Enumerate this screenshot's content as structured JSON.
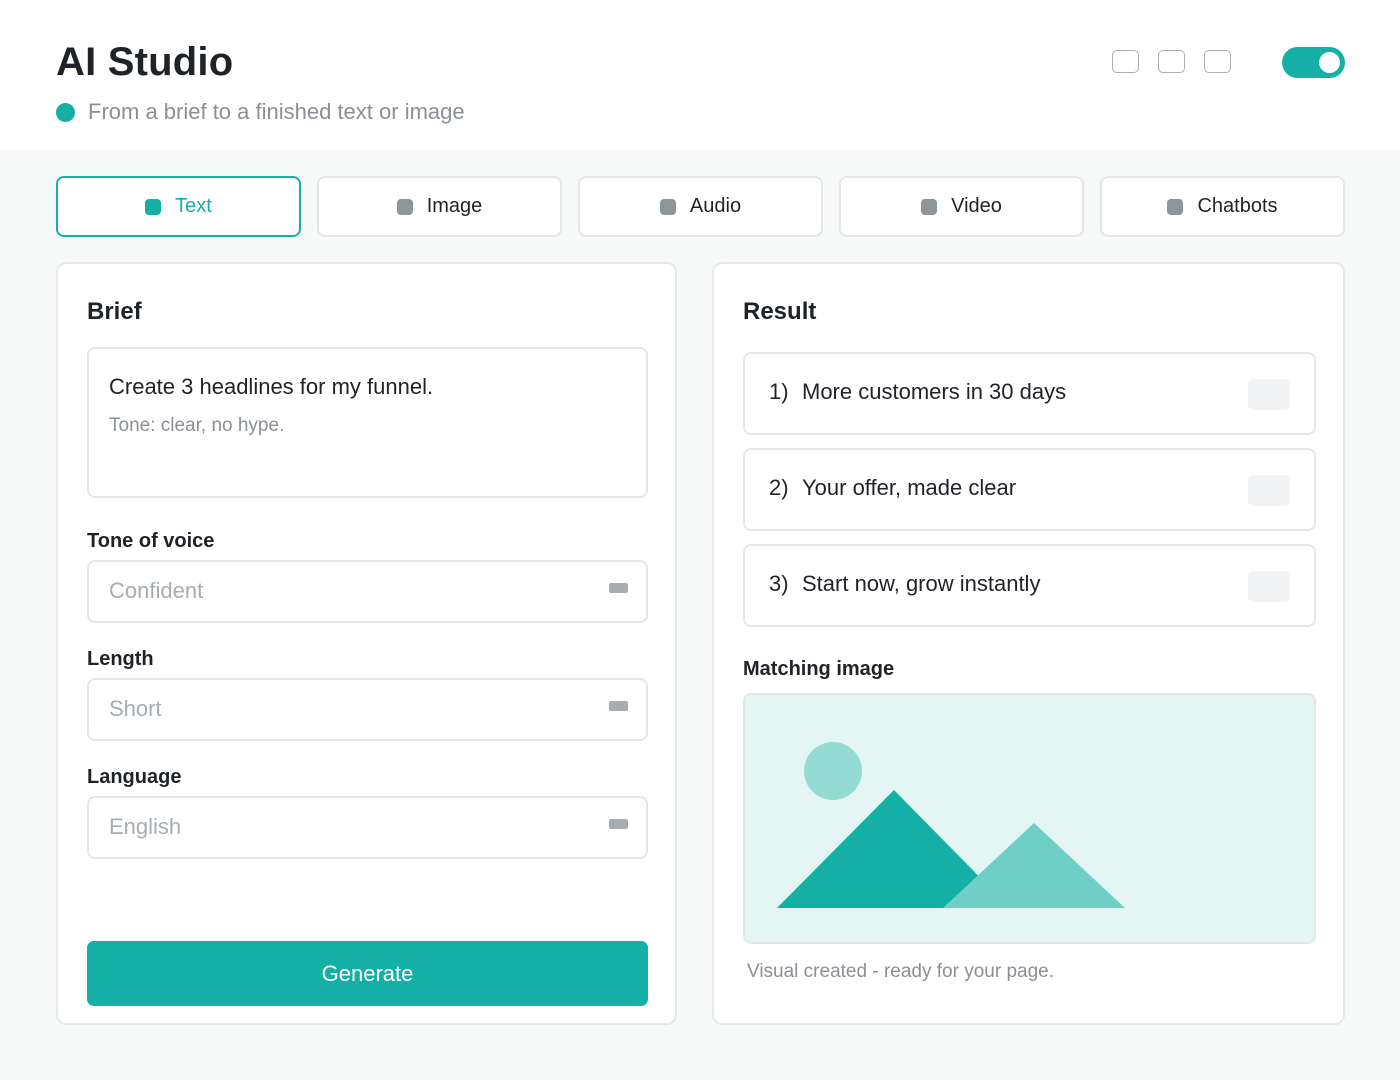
{
  "header": {
    "title": "AI Studio",
    "subtitle": "From a brief to a finished text or image",
    "toggle_on": true
  },
  "colors": {
    "accent": "#14b0a5",
    "accent_light": "#6fcec5",
    "sun": "#93dbd3",
    "image_bg": "#e3f6f4",
    "muted_text": "#8a9096"
  },
  "tabs": [
    {
      "label": "Text",
      "active": true
    },
    {
      "label": "Image",
      "active": false
    },
    {
      "label": "Audio",
      "active": false
    },
    {
      "label": "Video",
      "active": false
    },
    {
      "label": "Chatbots",
      "active": false
    }
  ],
  "brief": {
    "title": "Brief",
    "prompt": "Create 3 headlines for my funnel.",
    "note": "Tone: clear, no hype.",
    "fields": [
      {
        "label": "Tone of voice",
        "value": "Confident"
      },
      {
        "label": "Length",
        "value": "Short"
      },
      {
        "label": "Language",
        "value": "English"
      }
    ],
    "generate_label": "Generate"
  },
  "result": {
    "title": "Result",
    "items": [
      {
        "num": "1)",
        "text": "More customers in 30 days"
      },
      {
        "num": "2)",
        "text": "Your offer, made clear"
      },
      {
        "num": "3)",
        "text": "Start now, grow instantly"
      }
    ],
    "image_label": "Matching image",
    "image_caption": "Visual created - ready for your page."
  }
}
